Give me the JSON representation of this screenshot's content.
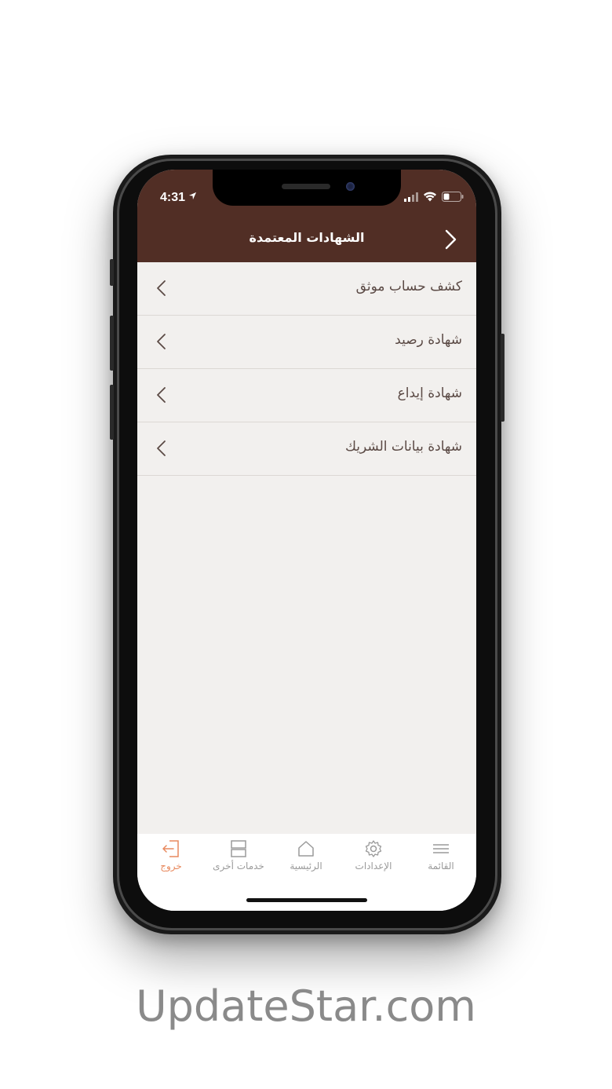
{
  "status_bar": {
    "time": "4:31"
  },
  "header": {
    "title": "الشهادات المعتمدة"
  },
  "list": {
    "items": [
      {
        "label": "كشف حساب موثق"
      },
      {
        "label": "شهادة رصيد"
      },
      {
        "label": "شهادة إيداع"
      },
      {
        "label": "شهادة بيانات الشريك"
      }
    ]
  },
  "tab_bar": {
    "tabs": [
      {
        "label": "خروج",
        "icon": "logout-icon",
        "active": true
      },
      {
        "label": "خدمات أخرى",
        "icon": "services-icon",
        "active": false
      },
      {
        "label": "الرئيسية",
        "icon": "home-icon",
        "active": false
      },
      {
        "label": "الإعدادات",
        "icon": "gear-icon",
        "active": false
      },
      {
        "label": "القائمة",
        "icon": "menu-icon",
        "active": false
      }
    ]
  },
  "colors": {
    "header_bg": "#512e25",
    "accent": "#e8895e",
    "list_bg": "#f2f0ee"
  },
  "watermark": "UpdateStar.com"
}
